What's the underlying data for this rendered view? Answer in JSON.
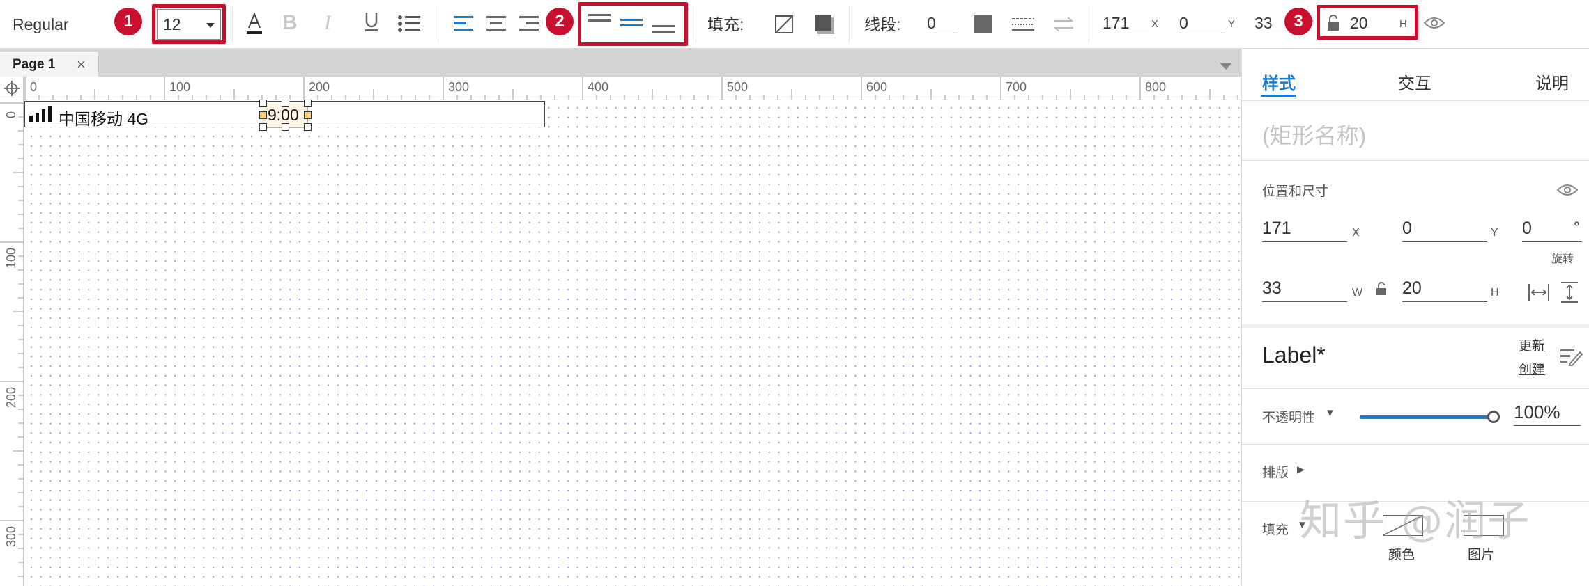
{
  "toolbar": {
    "font_style": "Regular",
    "font_size": "12",
    "fill_label": "填充:",
    "stroke_label": "线段:",
    "stroke_width": "0",
    "x_value": "171",
    "x_label": "X",
    "y_value": "0",
    "y_label": "Y",
    "w_value": "33",
    "w_label": "W",
    "h_value": "20",
    "h_label": "H"
  },
  "annotations": {
    "badge1": "1",
    "badge2": "2",
    "badge3": "3",
    "color": "#c8102e"
  },
  "tabs": {
    "page1": "Page 1"
  },
  "ruler_top": [
    "0",
    "100",
    "200",
    "300",
    "400",
    "500",
    "600",
    "700",
    "800"
  ],
  "ruler_left": [
    "0",
    "100",
    "200",
    "300"
  ],
  "canvas": {
    "carrier": "中国移动 4G",
    "time": "9:00"
  },
  "panel": {
    "tabs": {
      "style": "样式",
      "interaction": "交互",
      "notes": "说明"
    },
    "name_placeholder": "(矩形名称)",
    "position_size_label": "位置和尺寸",
    "x_value": "171",
    "x_label": "X",
    "y_value": "0",
    "y_label": "Y",
    "rotation_value": "0",
    "rotation_unit": "°",
    "rotation_label": "旋转",
    "w_value": "33",
    "w_label": "W",
    "h_value": "20",
    "h_label": "H",
    "style_name": "Label*",
    "update_link": "更新",
    "create_link": "创建",
    "opacity_label": "不透明性",
    "opacity_value": "100%",
    "opacity_fraction": 1.0,
    "typography_label": "排版",
    "fill_label": "填充",
    "fill_color_label": "颜色",
    "fill_image_label": "图片"
  },
  "watermark": "知乎 @润子",
  "colors": {
    "accent": "#1a7bd1",
    "highlight": "#c8102e"
  }
}
